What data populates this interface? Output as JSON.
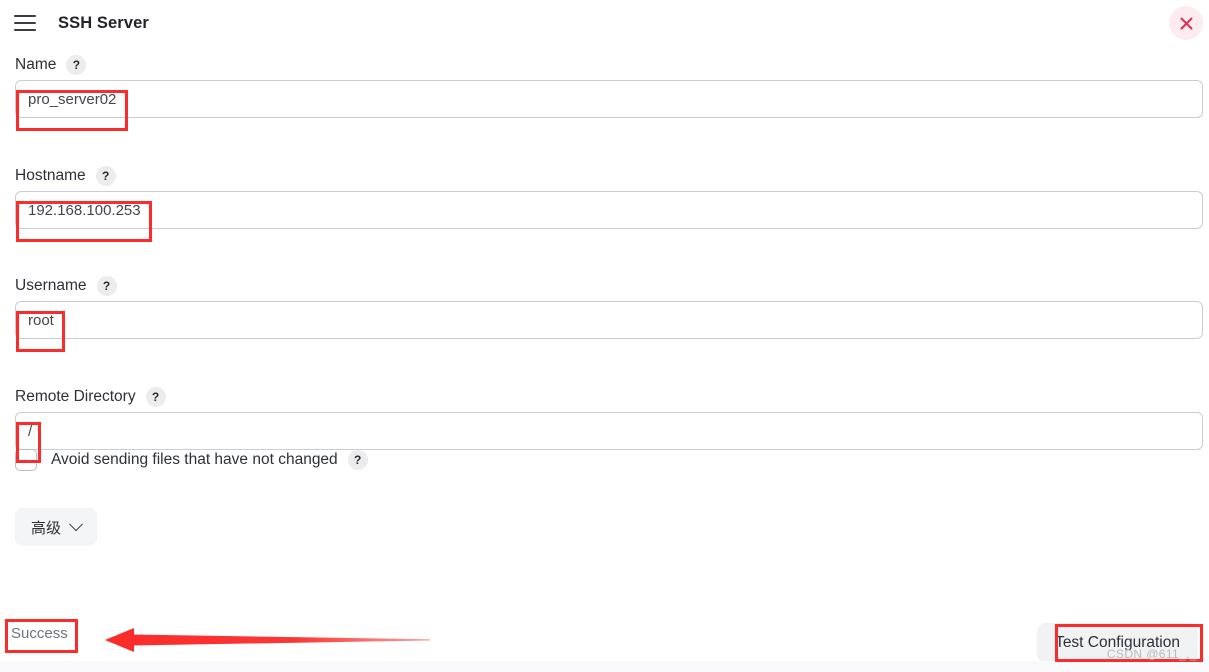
{
  "window": {
    "title": "SSH Server",
    "menu_icon": "hamburger-icon",
    "close_icon": "close-icon",
    "accent_red": "#fb2c2c",
    "close_bg": "#fdecef"
  },
  "fields": {
    "name": {
      "label": "Name",
      "help": "?",
      "value": "pro_server02",
      "placeholder": ""
    },
    "hostname": {
      "label": "Hostname",
      "help": "?",
      "value": "192.168.100.253",
      "placeholder": ""
    },
    "username": {
      "label": "Username",
      "help": "?",
      "value": "root",
      "placeholder": ""
    },
    "remote_directory": {
      "label": "Remote Directory",
      "help": "?",
      "value": "/",
      "placeholder": ""
    }
  },
  "checkbox": {
    "label": "Avoid sending files that have not changed",
    "help": "?",
    "checked": false
  },
  "advanced": {
    "label": "高级",
    "chevron": "chevron-down-icon"
  },
  "footer": {
    "status": "Success",
    "test_button": "Test Configuration"
  },
  "watermark": {
    "text": "CSDN @611_._"
  }
}
